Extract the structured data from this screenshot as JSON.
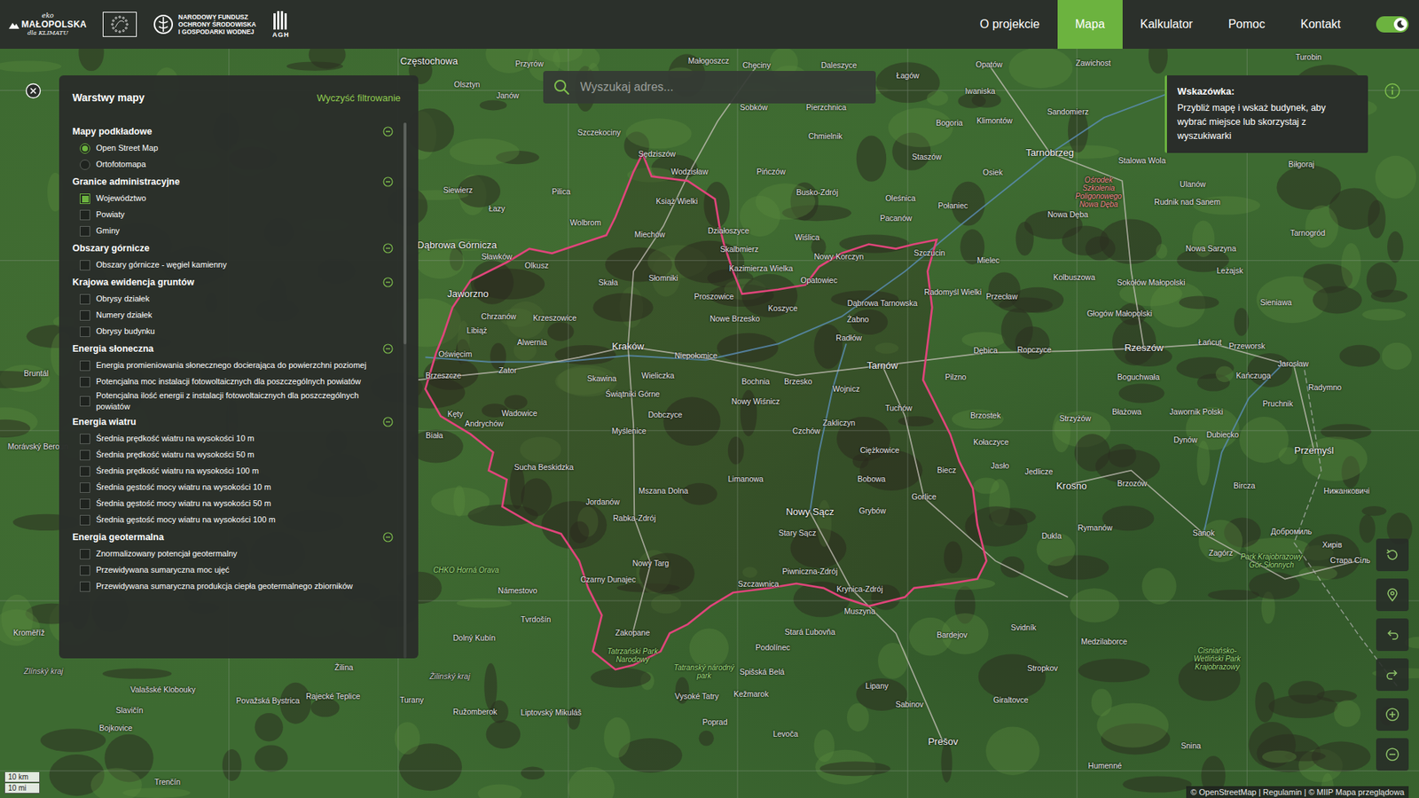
{
  "header": {
    "logos": {
      "eko": "eko",
      "malopolska": "MAŁOPOLSKA",
      "klimat": "dla KLIMATU",
      "nfos": [
        "NARODOWY FUNDUSZ",
        "OCHRONY ŚRODOWISKA",
        "I GOSPODARKI WODNEJ"
      ],
      "agh": "AGH"
    },
    "nav": [
      {
        "label": "O projekcie",
        "selected": false
      },
      {
        "label": "Mapa",
        "selected": true
      },
      {
        "label": "Kalkulator",
        "selected": false
      },
      {
        "label": "Pomoc",
        "selected": false
      },
      {
        "label": "Kontakt",
        "selected": false
      }
    ],
    "dark_mode": {
      "on": true
    }
  },
  "search": {
    "placeholder": "Wyszukaj adres..."
  },
  "layers_panel": {
    "title": "Warstwy mapy",
    "clear": "Wyczyść filtrowanie",
    "sections": [
      {
        "title": "Mapy podkładowe",
        "expanded": true,
        "items": [
          {
            "label": "Open Street Map",
            "kind": "radio",
            "selected": true
          },
          {
            "label": "Ortofotomapa",
            "kind": "radio",
            "selected": false
          }
        ]
      },
      {
        "title": "Granice administracyjne",
        "expanded": true,
        "items": [
          {
            "label": "Województwo",
            "kind": "checkbox",
            "checked": true
          },
          {
            "label": "Powiaty",
            "kind": "checkbox",
            "checked": false
          },
          {
            "label": "Gminy",
            "kind": "checkbox",
            "checked": false
          }
        ]
      },
      {
        "title": "Obszary górnicze",
        "expanded": true,
        "items": [
          {
            "label": "Obszary górnicze - węgiel kamienny",
            "kind": "checkbox",
            "checked": false
          }
        ]
      },
      {
        "title": "Krajowa ewidencja gruntów",
        "expanded": true,
        "items": [
          {
            "label": "Obrysy działek",
            "kind": "checkbox",
            "checked": false
          },
          {
            "label": "Numery działek",
            "kind": "checkbox",
            "checked": false
          },
          {
            "label": "Obrysy budynku",
            "kind": "checkbox",
            "checked": false
          }
        ]
      },
      {
        "title": "Energia słoneczna",
        "expanded": true,
        "items": [
          {
            "label": "Energia promieniowania słonecznego docierająca do powierzchni poziomej",
            "kind": "checkbox",
            "checked": false
          },
          {
            "label": "Potencjalna moc instalacji fotowoltaicznych dla poszczególnych powiatów",
            "kind": "checkbox",
            "checked": false
          },
          {
            "label": "Potencjalna ilość energii z instalacji fotowoltaicznych dla poszczególnych powiatów",
            "kind": "checkbox",
            "checked": false
          }
        ]
      },
      {
        "title": "Energia wiatru",
        "expanded": true,
        "items": [
          {
            "label": "Średnia prędkość wiatru na wysokości 10 m",
            "kind": "checkbox",
            "checked": false
          },
          {
            "label": "Średnia prędkość wiatru na wysokości 50 m",
            "kind": "checkbox",
            "checked": false
          },
          {
            "label": "Średnia prędkość wiatru na wysokości 100 m",
            "kind": "checkbox",
            "checked": false
          },
          {
            "label": "Średnia gęstość mocy wiatru na wysokości 10 m",
            "kind": "checkbox",
            "checked": false
          },
          {
            "label": "Średnia gęstość mocy wiatru na wysokości 50 m",
            "kind": "checkbox",
            "checked": false
          },
          {
            "label": "Średnia gęstość mocy wiatru na wysokości 100 m",
            "kind": "checkbox",
            "checked": false
          }
        ]
      },
      {
        "title": "Energia geotermalna",
        "expanded": true,
        "items": [
          {
            "label": "Znormalizowany potencjał geotermalny",
            "kind": "checkbox",
            "checked": false
          },
          {
            "label": "Przewidywana sumaryczna moc ujęć",
            "kind": "checkbox",
            "checked": false
          },
          {
            "label": "Przewidywana sumaryczna produkcja ciepła geotermalnego zbiorników",
            "kind": "checkbox",
            "checked": false
          }
        ]
      }
    ]
  },
  "hint": {
    "title": "Wskazówka:",
    "text": "Przybliż mapę i wskaż budynek, aby wybrać miejsce lub skorzystaj z wyszukiwarki"
  },
  "map": {
    "labels": [
      {
        "text": "Częstochowa",
        "kind": "city"
      },
      {
        "text": "Olsztyn",
        "kind": "town"
      },
      {
        "text": "Janów",
        "kind": "town"
      },
      {
        "text": "Przyrów",
        "kind": "town"
      },
      {
        "text": "Małogoszcz",
        "kind": "town"
      },
      {
        "text": "Chęciny",
        "kind": "town"
      },
      {
        "text": "Daleszyce",
        "kind": "town"
      },
      {
        "text": "Łagów",
        "kind": "town"
      },
      {
        "text": "Opatów",
        "kind": "town"
      },
      {
        "text": "Zawichost",
        "kind": "town"
      },
      {
        "text": "Turobin",
        "kind": "town"
      },
      {
        "text": "Iwaniska",
        "kind": "town"
      },
      {
        "text": "Sobków",
        "kind": "town"
      },
      {
        "text": "Pierzchnica",
        "kind": "town"
      },
      {
        "text": "Sandomierz",
        "kind": "town"
      },
      {
        "text": "Klimontów",
        "kind": "town"
      },
      {
        "text": "Bogoria",
        "kind": "town"
      },
      {
        "text": "Szczekociny",
        "kind": "town"
      },
      {
        "text": "Chmielnik",
        "kind": "town"
      },
      {
        "text": "Sędziszów",
        "kind": "town"
      },
      {
        "text": "Tarnobrzeg",
        "kind": "city"
      },
      {
        "text": "Staszów",
        "kind": "town"
      },
      {
        "text": "Stalowa Wola",
        "kind": "town"
      },
      {
        "text": "Biłgoraj",
        "kind": "town"
      },
      {
        "text": "Wodzisław",
        "kind": "town"
      },
      {
        "text": "Pińczów",
        "kind": "town"
      },
      {
        "text": "Osiek",
        "kind": "town"
      },
      {
        "text": "Ulanów",
        "kind": "town"
      },
      {
        "text": "Pilica",
        "kind": "town"
      },
      {
        "text": "Busko-Zdrój",
        "kind": "town"
      },
      {
        "text": "Siewierz",
        "kind": "town"
      },
      {
        "text": "Oleśnica",
        "kind": "town"
      },
      {
        "text": "Książ Wielki",
        "kind": "town"
      },
      {
        "text": "Połaniec",
        "kind": "town"
      },
      {
        "text": "Rudnik nad Sanem",
        "kind": "town"
      },
      {
        "text": "Łazy",
        "kind": "town"
      },
      {
        "text": "Nowa Dęba",
        "kind": "town"
      },
      {
        "text": "Pacanów",
        "kind": "town"
      },
      {
        "text": "Wolbrom",
        "kind": "town"
      },
      {
        "text": "Działoszyce",
        "kind": "town"
      },
      {
        "text": "Tarnogród",
        "kind": "town"
      },
      {
        "text": "Miechów",
        "kind": "town"
      },
      {
        "text": "Wiślica",
        "kind": "town"
      },
      {
        "text": "Dąbrowa Górnicza",
        "kind": "city"
      },
      {
        "text": "Nowa Sarzyna",
        "kind": "town"
      },
      {
        "text": "Skalbmierz",
        "kind": "town"
      },
      {
        "text": "Szczucin",
        "kind": "town"
      },
      {
        "text": "Sławków",
        "kind": "town"
      },
      {
        "text": "Nowy Korczyn",
        "kind": "town"
      },
      {
        "text": "Mielec",
        "kind": "town"
      },
      {
        "text": "Olkusz",
        "kind": "town"
      },
      {
        "text": "Kazimierza Wielka",
        "kind": "town"
      },
      {
        "text": "Leżajsk",
        "kind": "town"
      },
      {
        "text": "Kolbuszowa",
        "kind": "town"
      },
      {
        "text": "Słomniki",
        "kind": "town"
      },
      {
        "text": "Opatowiec",
        "kind": "town"
      },
      {
        "text": "Skała",
        "kind": "town"
      },
      {
        "text": "Sokołów Małopolski",
        "kind": "town"
      },
      {
        "text": "Radomyśl Wielki",
        "kind": "town"
      },
      {
        "text": "Jaworzno",
        "kind": "city"
      },
      {
        "text": "Proszowice",
        "kind": "town"
      },
      {
        "text": "Przecław",
        "kind": "town"
      },
      {
        "text": "Sieniawa",
        "kind": "town"
      },
      {
        "text": "Dąbrowa Tarnowska",
        "kind": "town"
      },
      {
        "text": "Koszyce",
        "kind": "town"
      },
      {
        "text": "Głogów Małopolski",
        "kind": "town"
      },
      {
        "text": "Chrzanów",
        "kind": "town"
      },
      {
        "text": "Krzeszowice",
        "kind": "town"
      },
      {
        "text": "Nowe Brzesko",
        "kind": "town"
      },
      {
        "text": "Żabno",
        "kind": "town"
      },
      {
        "text": "Libiąż",
        "kind": "town"
      },
      {
        "text": "Radłów",
        "kind": "town"
      },
      {
        "text": "Alwernia",
        "kind": "town"
      },
      {
        "text": "Łańcut",
        "kind": "town"
      },
      {
        "text": "Kraków",
        "kind": "city"
      },
      {
        "text": "Przeworsk",
        "kind": "town"
      },
      {
        "text": "Rzeszów",
        "kind": "city"
      },
      {
        "text": "Ropczyce",
        "kind": "town"
      },
      {
        "text": "Dębica",
        "kind": "town"
      },
      {
        "text": "Oświęcim",
        "kind": "town"
      },
      {
        "text": "Niepołomice",
        "kind": "town"
      },
      {
        "text": "Jarosław",
        "kind": "town"
      },
      {
        "text": "Tarnów",
        "kind": "city"
      },
      {
        "text": "Zator",
        "kind": "town"
      },
      {
        "text": "Wieliczka",
        "kind": "town"
      },
      {
        "text": "Brzeszcze",
        "kind": "town"
      },
      {
        "text": "Kańczuga",
        "kind": "town"
      },
      {
        "text": "Pilzno",
        "kind": "town"
      },
      {
        "text": "Boguchwała",
        "kind": "town"
      },
      {
        "text": "Skawina",
        "kind": "town"
      },
      {
        "text": "Bochnia",
        "kind": "town"
      },
      {
        "text": "Brzesko",
        "kind": "town"
      },
      {
        "text": "Wojnicz",
        "kind": "town"
      },
      {
        "text": "Radymno",
        "kind": "town"
      },
      {
        "text": "Świątniki Górne",
        "kind": "town"
      },
      {
        "text": "Nowy Wiśnicz",
        "kind": "town"
      },
      {
        "text": "Pruchnik",
        "kind": "town"
      },
      {
        "text": "Tuchów",
        "kind": "town"
      },
      {
        "text": "Błażowa",
        "kind": "town"
      },
      {
        "text": "Jawornik Polski",
        "kind": "town"
      },
      {
        "text": "Kęty",
        "kind": "town"
      },
      {
        "text": "Wadowice",
        "kind": "town"
      },
      {
        "text": "Dobczyce",
        "kind": "town"
      },
      {
        "text": "Brzostek",
        "kind": "town"
      },
      {
        "text": "Strzyżów",
        "kind": "town"
      },
      {
        "text": "Zakliczyn",
        "kind": "town"
      },
      {
        "text": "Andrychów",
        "kind": "town"
      },
      {
        "text": "Myślenice",
        "kind": "town"
      },
      {
        "text": "Czchów",
        "kind": "town"
      },
      {
        "text": "Dubiecko",
        "kind": "town"
      },
      {
        "text": "Biała",
        "kind": "town"
      },
      {
        "text": "Dynów",
        "kind": "town"
      },
      {
        "text": "Kołaczyce",
        "kind": "town"
      },
      {
        "text": "Ciężkowice",
        "kind": "town"
      },
      {
        "text": "Przemyśl",
        "kind": "city"
      },
      {
        "text": "Jasło",
        "kind": "town"
      },
      {
        "text": "Sucha Beskidzka",
        "kind": "town"
      },
      {
        "text": "Biecz",
        "kind": "town"
      },
      {
        "text": "Jedlicze",
        "kind": "town"
      },
      {
        "text": "Limanowa",
        "kind": "town"
      },
      {
        "text": "Bobowa",
        "kind": "town"
      },
      {
        "text": "Krosno",
        "kind": "city"
      },
      {
        "text": "Brzozów",
        "kind": "town"
      },
      {
        "text": "Bircza",
        "kind": "town"
      },
      {
        "text": "Нижанковичі",
        "kind": "town"
      },
      {
        "text": "Mszana Dolna",
        "kind": "town"
      },
      {
        "text": "Gorlice",
        "kind": "town"
      },
      {
        "text": "Jordanów",
        "kind": "town"
      },
      {
        "text": "Grybów",
        "kind": "town"
      },
      {
        "text": "Nowy Sącz",
        "kind": "city"
      },
      {
        "text": "Rabka-Zdrój",
        "kind": "town"
      },
      {
        "text": "Rymanów",
        "kind": "town"
      },
      {
        "text": "Добромиль",
        "kind": "town"
      },
      {
        "text": "Stary Sącz",
        "kind": "town"
      },
      {
        "text": "Sanok",
        "kind": "town"
      },
      {
        "text": "Dukla",
        "kind": "town"
      },
      {
        "text": "Хирів",
        "kind": "town"
      },
      {
        "text": "Zagórz",
        "kind": "town"
      },
      {
        "text": "Стара Сіль",
        "kind": "town"
      },
      {
        "text": "Nowy Targ",
        "kind": "town"
      },
      {
        "text": "Piwniczna-Zdrój",
        "kind": "town"
      },
      {
        "text": "Czarny Dunajec",
        "kind": "town"
      },
      {
        "text": "Szczawnica",
        "kind": "town"
      },
      {
        "text": "Krynica-Zdrój",
        "kind": "town"
      },
      {
        "text": "Námestovo",
        "kind": "town"
      },
      {
        "text": "Muszyna",
        "kind": "town"
      },
      {
        "text": "Tvrdošín",
        "kind": "town"
      },
      {
        "text": "Svidník",
        "kind": "town"
      },
      {
        "text": "Stará Ľubovňa",
        "kind": "town"
      },
      {
        "text": "Zakopane",
        "kind": "town"
      },
      {
        "text": "Bardejov",
        "kind": "town"
      },
      {
        "text": "Dolný Kubín",
        "kind": "town"
      },
      {
        "text": "Medzilaborce",
        "kind": "town"
      },
      {
        "text": "Podolínec",
        "kind": "town"
      },
      {
        "text": "Tatrzański Park Narodowy",
        "kind": "park"
      },
      {
        "text": "Tatranský národný park",
        "kind": "park"
      },
      {
        "text": "Stropkov",
        "kind": "town"
      },
      {
        "text": "Spišská Belá",
        "kind": "town"
      },
      {
        "text": "Lipany",
        "kind": "town"
      },
      {
        "text": "Vysoké Tatry",
        "kind": "town"
      },
      {
        "text": "Kežmarok",
        "kind": "town"
      },
      {
        "text": "Giraltovce",
        "kind": "town"
      },
      {
        "text": "Turany",
        "kind": "town"
      },
      {
        "text": "Sabinov",
        "kind": "town"
      },
      {
        "text": "Ružomberok",
        "kind": "town"
      },
      {
        "text": "Liptovský Mikuláš",
        "kind": "town"
      },
      {
        "text": "Poprad",
        "kind": "town"
      },
      {
        "text": "Levoča",
        "kind": "town"
      },
      {
        "text": "Prešov",
        "kind": "city"
      },
      {
        "text": "Snina",
        "kind": "town"
      },
      {
        "text": "Humenné",
        "kind": "town"
      },
      {
        "text": "Trenčín",
        "kind": "town"
      },
      {
        "text": "Žilina",
        "kind": "town"
      },
      {
        "text": "Žilinský kraj",
        "kind": "region"
      },
      {
        "text": "Zlínský kraj",
        "kind": "region"
      },
      {
        "text": "Bruntál",
        "kind": "town"
      },
      {
        "text": "Morávský Beroun",
        "kind": "town"
      },
      {
        "text": "Kroměříž",
        "kind": "town"
      },
      {
        "text": "Valašské Klobouky",
        "kind": "town"
      },
      {
        "text": "Slavičín",
        "kind": "town"
      },
      {
        "text": "Bojkovice",
        "kind": "town"
      },
      {
        "text": "Považská Bystrica",
        "kind": "town"
      },
      {
        "text": "Rajecké Teplice",
        "kind": "town"
      },
      {
        "text": "Ośrodek Szkolenia Poligonowego Nowa Dęba",
        "kind": "area"
      },
      {
        "text": "Park Krajobrazowy Gór Słonnych",
        "kind": "park"
      },
      {
        "text": "Cisniańsko-Wetliński Park Krajobrazowy",
        "kind": "park"
      },
      {
        "text": "CHKO Horná Orava",
        "kind": "park"
      }
    ],
    "scale": [
      "10 km",
      "10 mi"
    ],
    "attribution": "© OpenStreetMap | Regulamin | © MIIP Mapa przeglądowa"
  }
}
